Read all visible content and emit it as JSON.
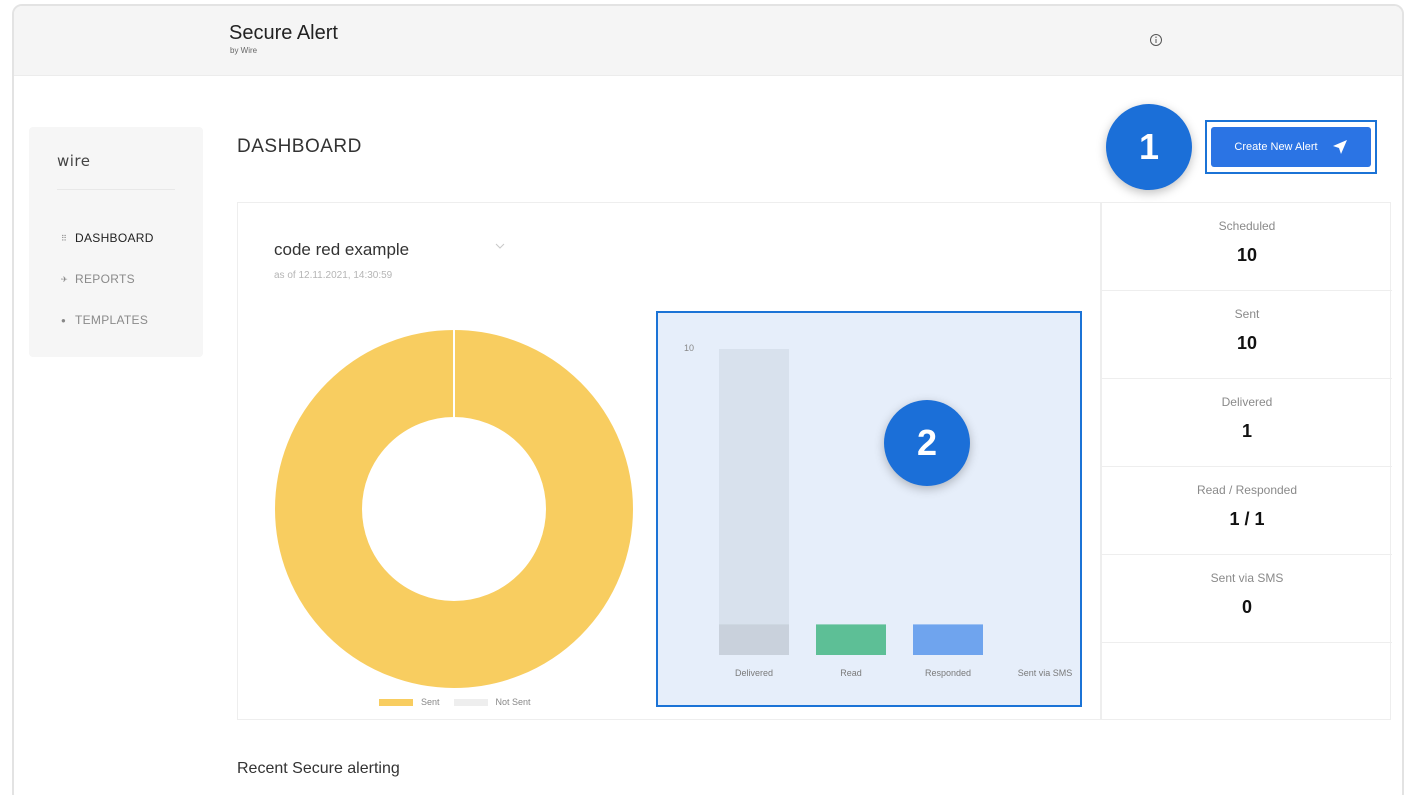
{
  "header": {
    "title": "Secure Alert",
    "subtitle": "by Wire"
  },
  "sidebar": {
    "brand": "wire",
    "items": [
      {
        "label": "DASHBOARD",
        "icon": "grid-icon",
        "active": true
      },
      {
        "label": "REPORTS",
        "icon": "reports-icon",
        "active": false
      },
      {
        "label": "TEMPLATES",
        "icon": "templates-icon",
        "active": false
      }
    ]
  },
  "main": {
    "title": "DASHBOARD",
    "create_button": {
      "label": "Create New Alert",
      "icon": "send-icon"
    },
    "alert": {
      "name": "code red example",
      "as_of": "as of 12.11.2021, 14:30:59"
    },
    "recent_title": "Recent Secure alerting"
  },
  "annotations": {
    "badge1": "1",
    "badge2": "2"
  },
  "stats": [
    {
      "label": "Scheduled",
      "value": "10"
    },
    {
      "label": "Sent",
      "value": "10"
    },
    {
      "label": "Delivered",
      "value": "1"
    },
    {
      "label": "Read / Responded",
      "value": "1 / 1"
    },
    {
      "label": "Sent via SMS",
      "value": "0"
    }
  ],
  "colors": {
    "accent": "#2b74e4",
    "sent": "#f8cd60",
    "not_sent": "#eeeeee",
    "delivered": "#c9d1dc",
    "read": "#5dbf96",
    "responded": "#6fa4ee"
  },
  "chart_data": [
    {
      "type": "pie",
      "labels": [
        "Sent",
        "Not Sent"
      ],
      "values": [
        10,
        0
      ],
      "legend": "bottom"
    },
    {
      "type": "bar",
      "categories": [
        "Delivered",
        "Read",
        "Responded",
        "Sent via SMS"
      ],
      "series": [
        {
          "values": [
            1,
            1,
            1,
            0
          ]
        }
      ],
      "max_label": "10",
      "ylim": [
        0,
        10
      ],
      "background_bar": {
        "category": "Delivered",
        "value": 10
      }
    }
  ]
}
